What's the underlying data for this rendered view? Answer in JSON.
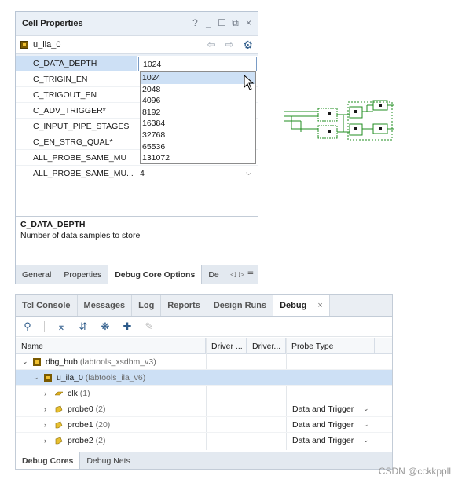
{
  "cell_properties": {
    "title": "Cell Properties",
    "window_controls": [
      "?",
      "_",
      "☐",
      "⧉",
      "×"
    ],
    "cell_name": "u_ila_0",
    "nav": {
      "back": "⇦",
      "forward": "⇨",
      "settings": "⚙"
    },
    "properties": [
      {
        "name": "C_DATA_DEPTH",
        "value": "1024"
      },
      {
        "name": "C_TRIGIN_EN",
        "value": ""
      },
      {
        "name": "C_TRIGOUT_EN",
        "value": ""
      },
      {
        "name": "C_ADV_TRIGGER*",
        "value": ""
      },
      {
        "name": "C_INPUT_PIPE_STAGES",
        "value": ""
      },
      {
        "name": "C_EN_STRG_QUAL*",
        "value": ""
      },
      {
        "name": "ALL_PROBE_SAME_MU",
        "value": ""
      },
      {
        "name": "ALL_PROBE_SAME_MU...",
        "value": "4"
      }
    ],
    "dropdown_options": [
      "1024",
      "2048",
      "4096",
      "8192",
      "16384",
      "32768",
      "65536",
      "131072"
    ],
    "selected_option": "1024",
    "description_title": "C_DATA_DEPTH",
    "description_text": "Number of data samples to store",
    "tabs": [
      "General",
      "Properties",
      "Debug Core Options",
      "De"
    ],
    "active_tab": "Debug Core Options",
    "tab_nav": [
      "◁",
      "▷",
      "☰"
    ]
  },
  "debug": {
    "tabs": [
      "Tcl Console",
      "Messages",
      "Log",
      "Reports",
      "Design Runs",
      "Debug"
    ],
    "active_tab": "Debug",
    "close": "×",
    "toolbar_icons": [
      "search-icon",
      "collapse-all-icon",
      "expand-all-icon",
      "bug-icon",
      "add-icon",
      "edit-icon"
    ],
    "columns": [
      "Name",
      "Driver ...",
      "Driver...",
      "Probe Type"
    ],
    "rows": [
      {
        "name": "dbg_hub",
        "detail": "(labtools_xsdbm_v3)",
        "probe_type": ""
      },
      {
        "name": "u_ila_0",
        "detail": "(labtools_ila_v6)",
        "probe_type": ""
      },
      {
        "name": "clk",
        "detail": "(1)",
        "probe_type": ""
      },
      {
        "name": "probe0",
        "detail": "(2)",
        "probe_type": "Data and Trigger"
      },
      {
        "name": "probe1",
        "detail": "(20)",
        "probe_type": "Data and Trigger"
      },
      {
        "name": "probe2",
        "detail": "(2)",
        "probe_type": "Data and Trigger"
      }
    ],
    "bottom_tabs": [
      "Debug Cores",
      "Debug Nets"
    ],
    "active_bottom_tab": "Debug Cores"
  },
  "watermark": "CSDN @cckkppll"
}
